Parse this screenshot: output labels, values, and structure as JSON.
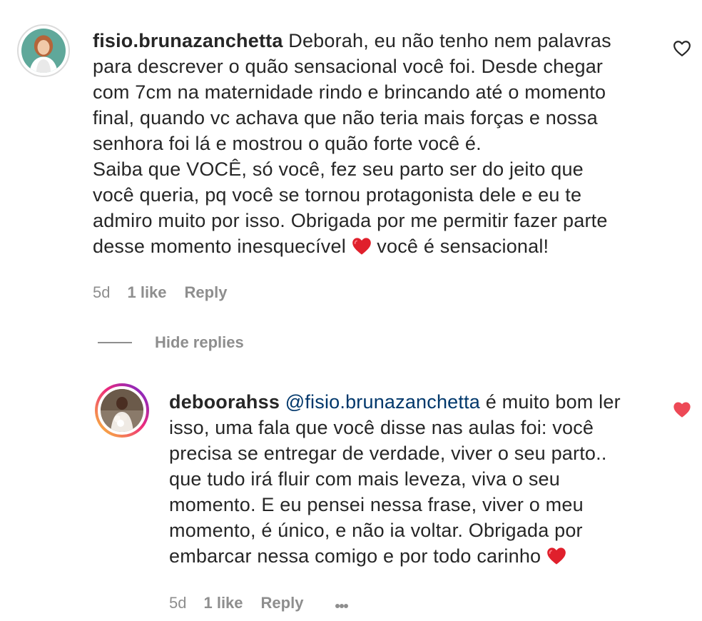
{
  "comments": [
    {
      "username": "fisio.brunazanchetta",
      "text_lines_part1": " Deborah, eu não tenho nem palavras\npara descrever o quão sensacional você foi. Desde chegar\ncom 7cm na maternidade rindo e brincando até o momento\nfinal, quando vc achava que não teria mais forças e nossa\nsenhora foi lá e mostrou o quão forte você é.\nSaiba que VOCÊ, só você, fez seu parto ser do jeito que\nvocê queria, pq você se tornou protagonista dele e eu te\nadmiro muito por isso. Obrigada por me permitir fazer parte\ndesse momento inesquecível ",
      "text_lines_part2": " você é sensacional!",
      "time": "5d",
      "likes": "1 like",
      "reply_label": "Reply",
      "liked": false
    }
  ],
  "hide_replies_label": "Hide replies",
  "reply": {
    "username": "deboorahss",
    "mention": "@fisio.brunazanchetta",
    "text_part1": " é muito bom ler\nisso, uma fala que você disse nas aulas foi: você\nprecisa se entregar de verdade, viver o seu parto..\nque tudo irá fluir com mais leveza, viva o seu\nmomento. E eu pensei nessa frase, viver o meu\nmomento, é único, e não ia voltar. Obrigada por\nembarcar nessa comigo e por todo carinho ",
    "time": "5d",
    "likes": "1 like",
    "reply_label": "Reply",
    "liked": true
  },
  "colors": {
    "heart_liked": "#ed4956",
    "meta_gray": "#8e8e8e",
    "mention_blue": "#00376b"
  }
}
